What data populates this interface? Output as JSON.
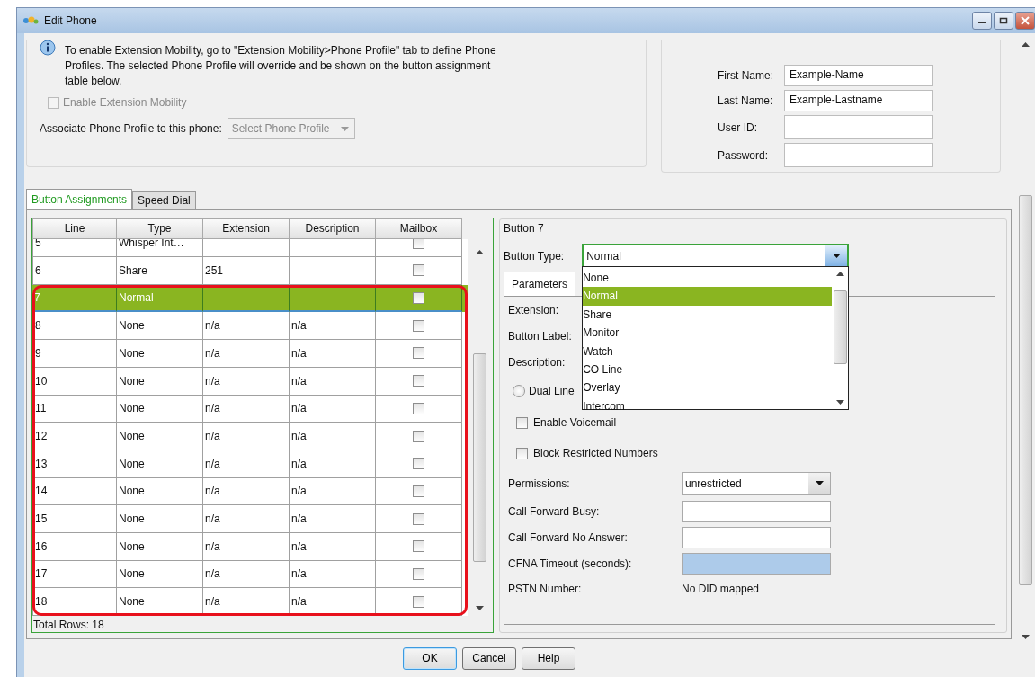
{
  "window": {
    "title": "Edit Phone"
  },
  "info": {
    "message": "To enable Extension Mobility, go to \"Extension Mobility>Phone Profile\" tab to define Phone Profiles. The selected Phone Profile will override and be shown on the button assignment table below.",
    "enable_mobility": {
      "label": "Enable Extension Mobility",
      "checked": false,
      "disabled": true
    },
    "profile": {
      "label": "Associate Phone Profile to this phone:",
      "value": "Select Phone Profile",
      "disabled": true
    }
  },
  "user": {
    "fields": [
      {
        "label": "First Name:",
        "value": "Example-Name"
      },
      {
        "label": "Last Name:",
        "value": "Example-Lastname"
      },
      {
        "label": "User ID:"
      },
      {
        "label": "Password:"
      }
    ]
  },
  "tabs": [
    {
      "label": "Button Assignments",
      "selected": true
    },
    {
      "label": "Speed Dial",
      "selected": false
    }
  ],
  "table": {
    "columns": [
      "Line",
      "Type",
      "Extension",
      "Description",
      "Mailbox"
    ],
    "rows": [
      {
        "line": "5",
        "type": "Whisper Int…",
        "mailbox": false,
        "selected": false,
        "outlined": false
      },
      {
        "line": "6",
        "type": "Share",
        "extension": "251",
        "mailbox": false,
        "selected": false,
        "outlined": false
      },
      {
        "line": "7",
        "type": "Normal",
        "mailbox": false,
        "selected": true,
        "outlined": true
      },
      {
        "line": "8",
        "type": "None",
        "extension": "n/a",
        "description": "n/a",
        "mailbox": false,
        "selected": false,
        "outlined": true
      },
      {
        "line": "9",
        "type": "None",
        "extension": "n/a",
        "description": "n/a",
        "mailbox": false,
        "selected": false,
        "outlined": true
      },
      {
        "line": "10",
        "type": "None",
        "extension": "n/a",
        "description": "n/a",
        "mailbox": false,
        "selected": false,
        "outlined": true
      },
      {
        "line": "11",
        "type": "None",
        "extension": "n/a",
        "description": "n/a",
        "mailbox": false,
        "selected": false,
        "outlined": true
      },
      {
        "line": "12",
        "type": "None",
        "extension": "n/a",
        "description": "n/a",
        "mailbox": false,
        "selected": false,
        "outlined": true
      },
      {
        "line": "13",
        "type": "None",
        "extension": "n/a",
        "description": "n/a",
        "mailbox": false,
        "selected": false,
        "outlined": true
      },
      {
        "line": "14",
        "type": "None",
        "extension": "n/a",
        "description": "n/a",
        "mailbox": false,
        "selected": false,
        "outlined": true
      },
      {
        "line": "15",
        "type": "None",
        "extension": "n/a",
        "description": "n/a",
        "mailbox": false,
        "selected": false,
        "outlined": true
      },
      {
        "line": "16",
        "type": "None",
        "extension": "n/a",
        "description": "n/a",
        "mailbox": false,
        "selected": false,
        "outlined": true
      },
      {
        "line": "17",
        "type": "None",
        "extension": "n/a",
        "description": "n/a",
        "mailbox": false,
        "selected": false,
        "outlined": true
      },
      {
        "line": "18",
        "type": "None",
        "extension": "n/a",
        "description": "n/a",
        "mailbox": false,
        "selected": false,
        "outlined": true
      }
    ],
    "footer": "Total Rows: 18"
  },
  "button_panel": {
    "title": "Button 7",
    "button_type": {
      "label": "Button Type:",
      "value": "Normal",
      "expanded": true,
      "options": [
        {
          "label": "None",
          "selected": false
        },
        {
          "label": "Normal",
          "selected": true
        },
        {
          "label": "Share",
          "selected": false
        },
        {
          "label": "Monitor",
          "selected": false
        },
        {
          "label": "Watch",
          "selected": false
        },
        {
          "label": "CO Line",
          "selected": false
        },
        {
          "label": "Overlay",
          "selected": false
        },
        {
          "label": "Intercom",
          "selected": false
        }
      ]
    },
    "tabs": [
      {
        "label": "Parameters",
        "selected": true
      }
    ],
    "fields": [
      {
        "kind": "label",
        "label": "Extension:"
      },
      {
        "kind": "label",
        "label": "Button Label:"
      },
      {
        "kind": "label",
        "label": "Description:"
      },
      {
        "kind": "radio",
        "label": "Dual Line",
        "checked": false
      },
      {
        "kind": "checkbox",
        "label": "Enable Voicemail",
        "checked": false
      },
      {
        "kind": "checkbox",
        "label": "Block Restricted Numbers",
        "checked": false
      },
      {
        "kind": "select",
        "label": "Permissions:",
        "value": "unrestricted"
      },
      {
        "kind": "input",
        "label": "Call Forward Busy:",
        "disabled": false
      },
      {
        "kind": "input",
        "label": "Call Forward No Answer:",
        "disabled": false
      },
      {
        "kind": "input",
        "label": "CFNA Timeout (seconds):",
        "disabled": true
      },
      {
        "kind": "text",
        "label": "PSTN Number:",
        "value": "No DID mapped"
      }
    ]
  },
  "buttons": [
    {
      "label": "OK",
      "focused": true
    },
    {
      "label": "Cancel",
      "focused": false
    },
    {
      "label": "Help",
      "focused": false
    }
  ]
}
